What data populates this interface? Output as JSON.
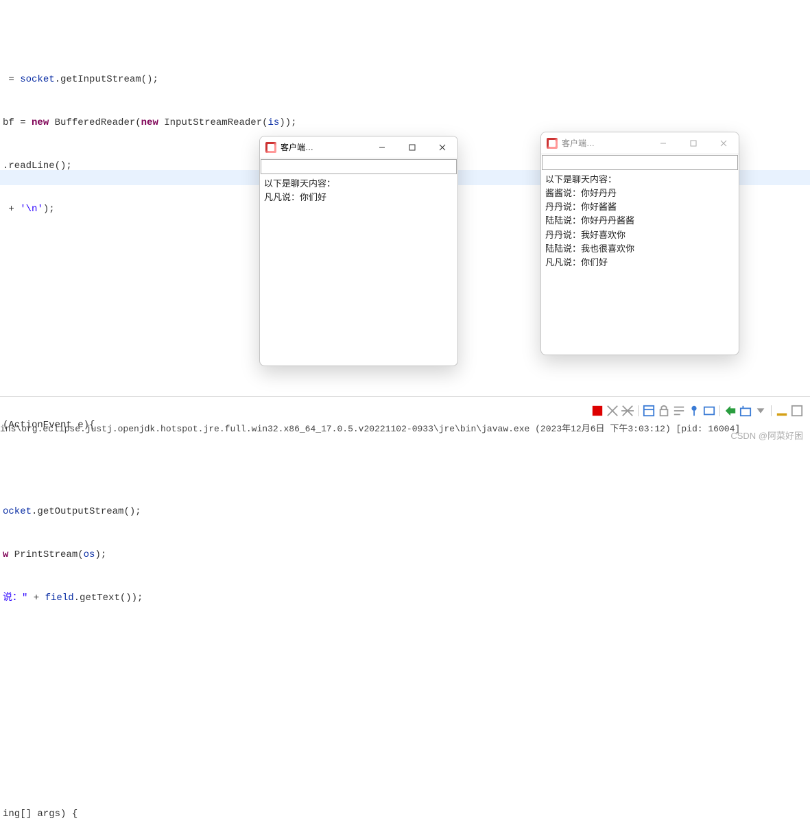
{
  "code": {
    "l1a": " = ",
    "l1b": "socket",
    "l1c": ".getInputStream();",
    "l2a": "bf = ",
    "l2b": "new",
    "l2c": " BufferedReader(",
    "l2d": "new",
    "l2e": " InputStreamReader(",
    "l2f": "is",
    "l2g": "));",
    "l3a": ".readLine();",
    "l4a": " + ",
    "l4b": "'\\n'",
    "l4c": ");",
    "l5a": "(ActionEvent e){",
    "l6a": "ocket",
    "l6b": ".getOutputStream();",
    "l7a": "w",
    "l7b": " PrintStream(",
    "l7c": "os",
    "l7d": ");",
    "l8a": "说：\"",
    "l8b": " + ",
    "l8c": "field",
    "l8d": ".getText());",
    "l9a": "ing[] args) {"
  },
  "window1": {
    "title": "客户端…",
    "input": "",
    "chat_header": "以下是聊天内容：",
    "lines": [
      "凡凡说：你们好"
    ]
  },
  "window2": {
    "title": "客户端…",
    "input": "",
    "chat_header": "以下是聊天内容：",
    "lines": [
      "酱酱说：你好丹丹",
      "丹丹说：你好酱酱",
      "陆陆说：你好丹丹酱酱",
      "丹丹说：我好喜欢你",
      "陆陆说：我也很喜欢你",
      "凡凡说：你们好"
    ]
  },
  "toolbar_icons": {
    "terminate": "stop-square-icon",
    "remove_all": "double-x-icon",
    "remove_launch": "gears-x-icon",
    "scroll_lock": "scroll-lock-icon",
    "word_wrap": "word-wrap-icon",
    "pin": "pin-console-icon",
    "show_console": "show-console-icon",
    "display": "display-selected-icon",
    "open": "open-console-icon",
    "min": "minimize-icon",
    "max": "maximize-icon"
  },
  "console_status": "ins\\org.eclipse.justj.openjdk.hotspot.jre.full.win32.x86_64_17.0.5.v20221102-0933\\jre\\bin\\javaw.exe  (2023年12月6日 下午3:03:12) [pid: 16004]",
  "watermark": "CSDN @阿菜好困"
}
